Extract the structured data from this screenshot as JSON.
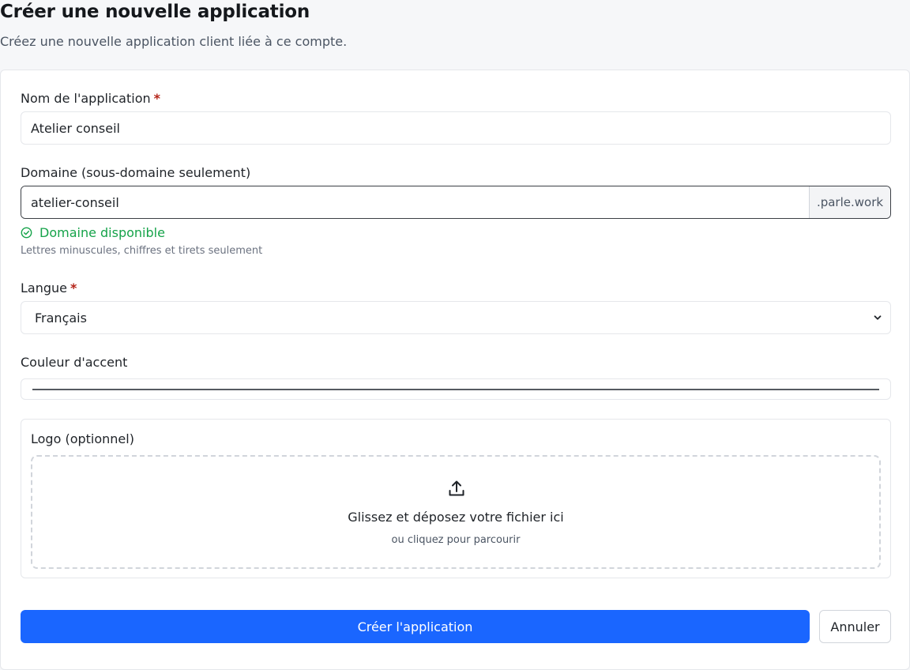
{
  "header": {
    "title": "Créer une nouvelle application",
    "subtitle": "Créez une nouvelle application client liée à ce compte."
  },
  "form": {
    "app_name": {
      "label": "Nom de l'application",
      "required_mark": "*",
      "value": "Atelier conseil"
    },
    "domain": {
      "label": "Domaine (sous-domaine seulement)",
      "value": "atelier-conseil",
      "suffix": ".parle.work",
      "status_icon": "check-circle-icon",
      "status_text": "Domaine disponible",
      "hint": "Lettres minuscules, chiffres et tirets seulement"
    },
    "language": {
      "label": "Langue",
      "required_mark": "*",
      "selected": "Français",
      "chevron_icon": "chevron-down-icon"
    },
    "accent_color": {
      "label": "Couleur d'accent",
      "value": "#555a60"
    },
    "logo": {
      "label": "Logo (optionnel)",
      "upload_icon": "upload-icon",
      "drop_title": "Glissez et déposez votre fichier ici",
      "drop_subtitle": "ou cliquez pour parcourir"
    }
  },
  "actions": {
    "submit_label": "Créer l'application",
    "cancel_label": "Annuler"
  },
  "colors": {
    "primary": "#1a66ff",
    "success": "#16a34a",
    "required": "#b42318"
  }
}
